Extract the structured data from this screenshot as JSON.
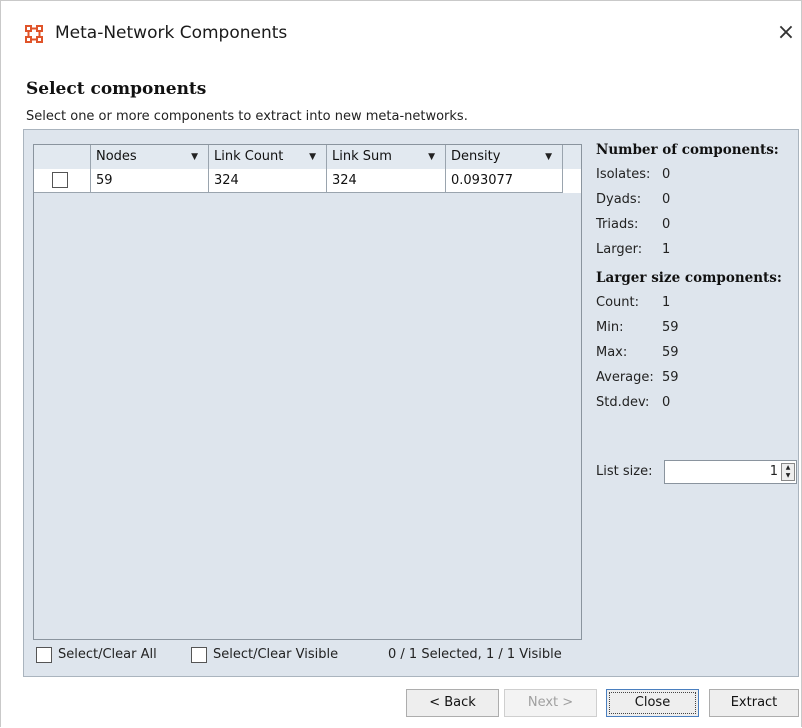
{
  "window": {
    "title": "Meta-Network Components",
    "close_glyph": "×",
    "app_icon": "network-grid-icon",
    "accent_color": "#e0542a"
  },
  "header": {
    "title": "Select components",
    "subtitle": "Select one or more components to extract into new meta-networks."
  },
  "table": {
    "columns": [
      "",
      "Nodes",
      "Link Count",
      "Link Sum",
      "Density"
    ],
    "sort_glyph": "▼",
    "rows": [
      {
        "checked": false,
        "nodes": "59",
        "link_count": "324",
        "link_sum": "324",
        "density": "0.093077"
      }
    ]
  },
  "stats": {
    "components_heading": "Number of components:",
    "isolates": {
      "label": "Isolates:",
      "value": "0"
    },
    "dyads": {
      "label": "Dyads:",
      "value": "0"
    },
    "triads": {
      "label": "Triads:",
      "value": "0"
    },
    "larger": {
      "label": "Larger:",
      "value": "1"
    },
    "larger_heading": "Larger size components:",
    "count": {
      "label": "Count:",
      "value": "1"
    },
    "min": {
      "label": "Min:",
      "value": "59"
    },
    "max": {
      "label": "Max:",
      "value": "59"
    },
    "average": {
      "label": "Average:",
      "value": "59"
    },
    "stddev": {
      "label": "Std.dev:",
      "value": "0"
    },
    "list_size": {
      "label": "List size:",
      "value": "1"
    }
  },
  "footer": {
    "select_all": "Select/Clear All",
    "select_visible": "Select/Clear Visible",
    "selection_status": "0 / 1 Selected, 1 / 1 Visible"
  },
  "buttons": {
    "back": "< Back",
    "next": "Next >",
    "close": "Close",
    "extract": "Extract"
  }
}
